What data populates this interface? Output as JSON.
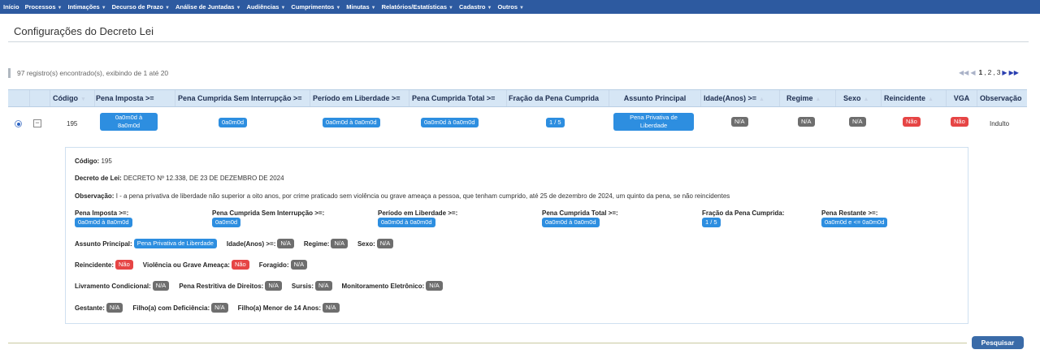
{
  "menu": [
    {
      "label": "Início",
      "caret": false
    },
    {
      "label": "Processos",
      "caret": true
    },
    {
      "label": "Intimações",
      "caret": true
    },
    {
      "label": "Decurso de Prazo",
      "caret": true
    },
    {
      "label": "Análise de Juntadas",
      "caret": true
    },
    {
      "label": "Audiências",
      "caret": true
    },
    {
      "label": "Cumprimentos",
      "caret": true
    },
    {
      "label": "Minutas",
      "caret": true
    },
    {
      "label": "Relatórios/Estatísticas",
      "caret": true
    },
    {
      "label": "Cadastro",
      "caret": true
    },
    {
      "label": "Outros",
      "caret": true
    }
  ],
  "page": {
    "title": "Configurações do Decreto Lei"
  },
  "records": {
    "text": "97 registro(s) encontrado(s), exibindo de 1 até 20"
  },
  "pagination": {
    "pages": [
      "1",
      "2",
      "3"
    ],
    "current": "1"
  },
  "table": {
    "headers": {
      "codigo": "Código",
      "pena_imposta": "Pena Imposta >=",
      "pena_cumprida_si": "Pena Cumprida Sem Interrupção >=",
      "periodo_liberdade": "Período em Liberdade >=",
      "pena_cumprida_total": "Pena Cumprida Total >=",
      "fracao": "Fração da Pena Cumprida",
      "assunto": "Assunto Principal",
      "idade": "Idade(Anos) >=",
      "regime": "Regime",
      "sexo": "Sexo",
      "reincidente": "Reincidente",
      "vga": "VGA",
      "observacao": "Observação"
    },
    "row": {
      "codigo": "195",
      "pena_imposta_1": "0a0m0d à",
      "pena_imposta_2": "8a0m0d",
      "pena_cumprida_si": "0a0m0d",
      "periodo_liberdade": "0a0m0d à 0a0m0d",
      "pena_cumprida_total": "0a0m0d à 0a0m0d",
      "fracao": "1 / 5",
      "assunto_1": "Pena Privativa de",
      "assunto_2": "Liberdade",
      "idade": "N/A",
      "regime": "N/A",
      "sexo": "N/A",
      "reincidente": "Não",
      "vga": "Não",
      "observacao": "Indulto"
    }
  },
  "detail": {
    "codigo_label": "Código:",
    "codigo_value": "195",
    "decreto_label": "Decreto de Lei:",
    "decreto_value": "DECRETO Nº 12.338, DE 23 DE DEZEMBRO DE 2024",
    "observacao_label": "Observação:",
    "observacao_value": "I - a pena privativa de liberdade não superior a oito anos, por crime praticado sem violência ou grave ameaça a pessoa, que tenham cumprido, até 25 de dezembro de 2024, um quinto da pena, se não reincidentes",
    "pena_imposta_label": "Pena Imposta >=:",
    "pena_imposta_value": "0a0m0d à 8a0m0d",
    "pena_cumprida_si_label": "Pena Cumprida Sem Interrupção >=:",
    "pena_cumprida_si_value": "0a0m0d",
    "periodo_label": "Período em Liberdade >=:",
    "periodo_value": "0a0m0d à 0a0m0d",
    "total_label": "Pena Cumprida Total >=:",
    "total_value": "0a0m0d à 0a0m0d",
    "fracao_label": "Fração da Pena Cumprida:",
    "fracao_value": "1 / 5",
    "restante_label": "Pena Restante >=:",
    "restante_value": "0a0m0d e <= 0a0m0d",
    "assunto_label": "Assunto Principal:",
    "assunto_value": "Pena Privativa de Liberdade",
    "idade_label": "Idade(Anos) >=:",
    "idade_value": "N/A",
    "regime_label": "Regime:",
    "regime_value": "N/A",
    "sexo_label": "Sexo:",
    "sexo_value": "N/A",
    "reincidente_label": "Reincidente:",
    "reincidente_value": "Não",
    "violencia_label": "Violência ou Grave Ameaça:",
    "violencia_value": "Não",
    "foragido_label": "Foragido:",
    "foragido_value": "N/A",
    "livramento_label": "Livramento Condicional:",
    "livramento_value": "N/A",
    "restritiva_label": "Pena Restritiva de Direitos:",
    "restritiva_value": "N/A",
    "sursis_label": "Sursis:",
    "sursis_value": "N/A",
    "monitoramento_label": "Monitoramento Eletrônico:",
    "monitoramento_value": "N/A",
    "gestante_label": "Gestante:",
    "gestante_value": "N/A",
    "filho_def_label": "Filho(a) com Deficiência:",
    "filho_def_value": "N/A",
    "filho_menor_label": "Filho(a) Menor de 14 Anos:",
    "filho_menor_value": "N/A"
  },
  "actions": {
    "search_label": "Pesquisar"
  },
  "colors": {
    "menu_bg": "#2d5aa0",
    "badge_blue": "#2d8ee0",
    "badge_grey": "#6e6e6e",
    "badge_red": "#e64545",
    "header_bg": "#d6e6f5"
  }
}
